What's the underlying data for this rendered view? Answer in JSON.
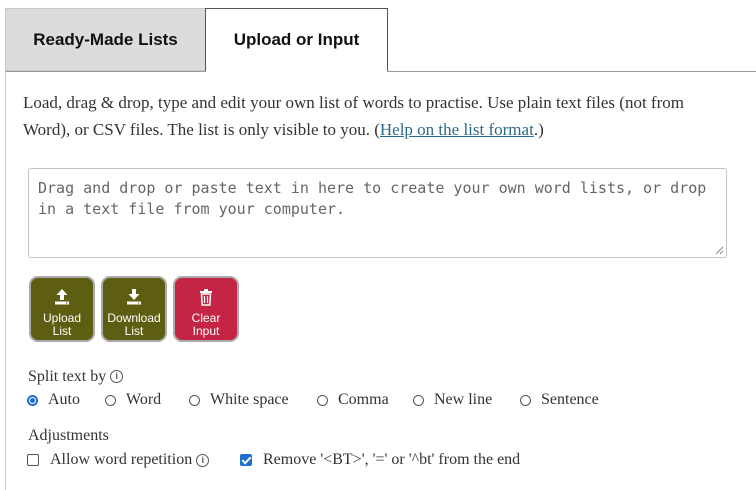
{
  "tabs": [
    {
      "label": "Ready-Made Lists",
      "active": false
    },
    {
      "label": "Upload or Input",
      "active": true
    }
  ],
  "intro": {
    "text_before": "Load, drag & drop, type and edit your own list of words to practise. Use plain text files (not from Word), or CSV files. The list is only visible to you. (",
    "link": "Help on the list format",
    "text_after": ".)"
  },
  "input": {
    "placeholder": "Drag and drop or paste text in here to create your own word lists, or drop in a text file from your computer.",
    "value": ""
  },
  "buttons": {
    "upload": {
      "line1": "Upload",
      "line2": "List",
      "icon": "upload-icon"
    },
    "download": {
      "line1": "Download",
      "line2": "List",
      "icon": "download-icon"
    },
    "clear": {
      "line1": "Clear",
      "line2": "Input",
      "icon": "trash-icon"
    }
  },
  "split": {
    "label": "Split text by",
    "info_icon": "info-icon",
    "options": [
      "Auto",
      "Word",
      "White space",
      "Comma",
      "New line",
      "Sentence"
    ],
    "selected": "Auto"
  },
  "adjustments": {
    "label": "Adjustments",
    "allow_repetition": {
      "label": "Allow word repetition",
      "checked": false
    },
    "remove_bt": {
      "label": "Remove '<BT>', '=' or '^bt' from the end",
      "checked": true
    }
  },
  "colors": {
    "olive_button": "#5e5e12",
    "red_button": "#c42545",
    "link": "#2a6a8a",
    "accent": "#1f6fd0"
  }
}
